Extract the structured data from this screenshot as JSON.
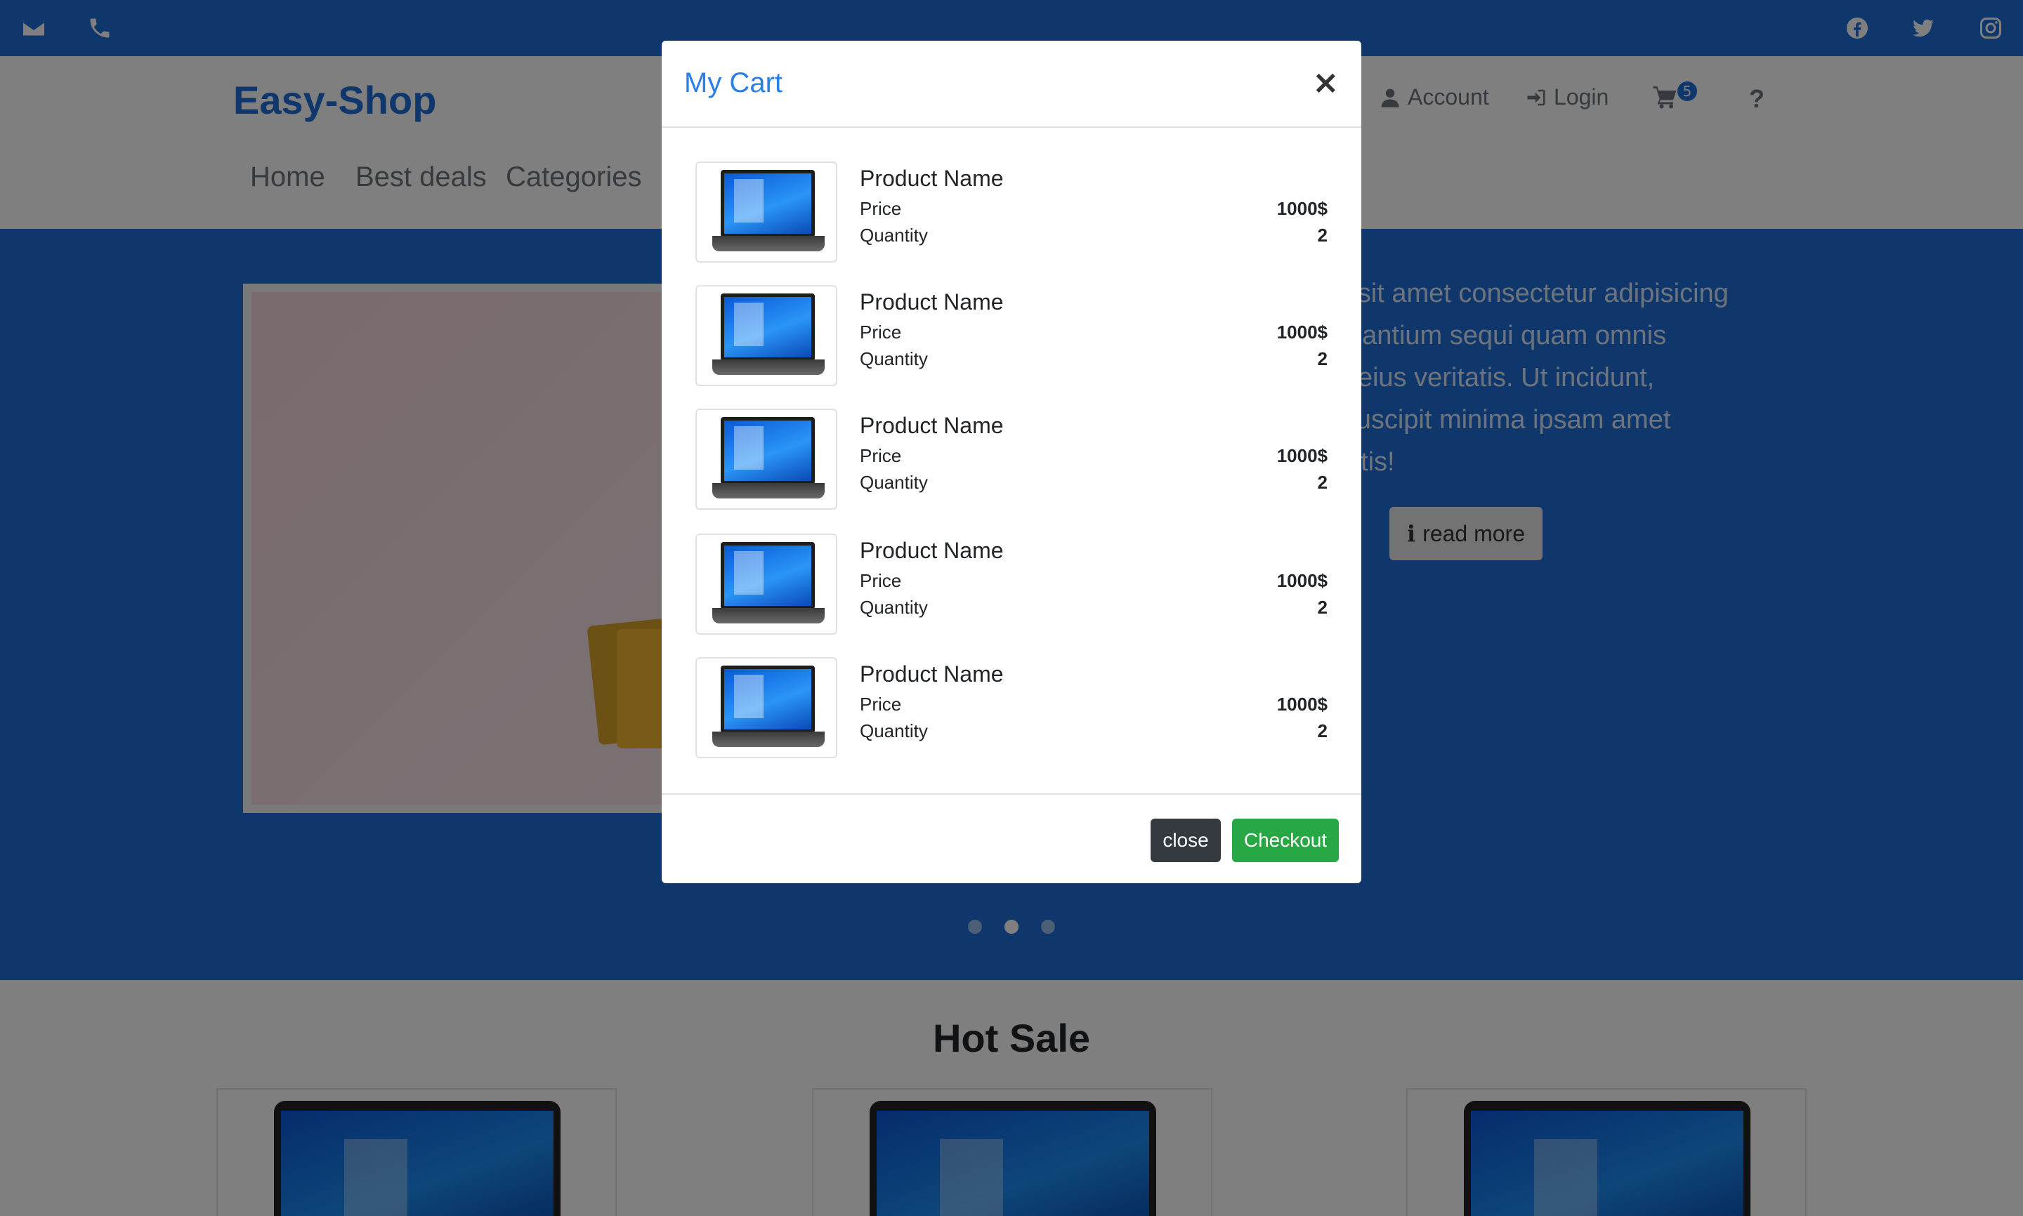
{
  "colors": {
    "primary": "#1f6fd6",
    "title_blue": "#2a7ee8",
    "dark_button": "#343a40",
    "success_button": "#28a745"
  },
  "topbar": {
    "left_icons": [
      "envelope-icon",
      "phone-icon"
    ],
    "right_icons": [
      "facebook-icon",
      "twitter-icon",
      "instagram-icon"
    ]
  },
  "header": {
    "logo": "Easy-Shop",
    "nav": [
      {
        "label": "Home"
      },
      {
        "label": "Best deals"
      },
      {
        "label": "Categories"
      }
    ],
    "account_label": "Account",
    "login_label": "Login",
    "cart_count": "5",
    "help_label": "?"
  },
  "hero": {
    "text": "lor sit amet consectetur adipisicing\ncusantium sequi quam omnis\n ab eius veritatis. Ut incidunt,\nn suscipit minima ipsam amet\niciatis!",
    "read_more_label": "read more",
    "slides": 3,
    "active_slide": 2
  },
  "hot_sale": {
    "title": "Hot Sale"
  },
  "cart_modal": {
    "title": "My Cart",
    "close_symbol": "×",
    "price_label": "Price",
    "quantity_label": "Quantity",
    "items": [
      {
        "name": "Product Name",
        "price": "1000$",
        "quantity": "2"
      },
      {
        "name": "Product Name",
        "price": "1000$",
        "quantity": "2"
      },
      {
        "name": "Product Name",
        "price": "1000$",
        "quantity": "2"
      },
      {
        "name": "Product Name",
        "price": "1000$",
        "quantity": "2"
      },
      {
        "name": "Product Name",
        "price": "1000$",
        "quantity": "2"
      }
    ],
    "close_button": "close",
    "checkout_button": "Checkout"
  }
}
